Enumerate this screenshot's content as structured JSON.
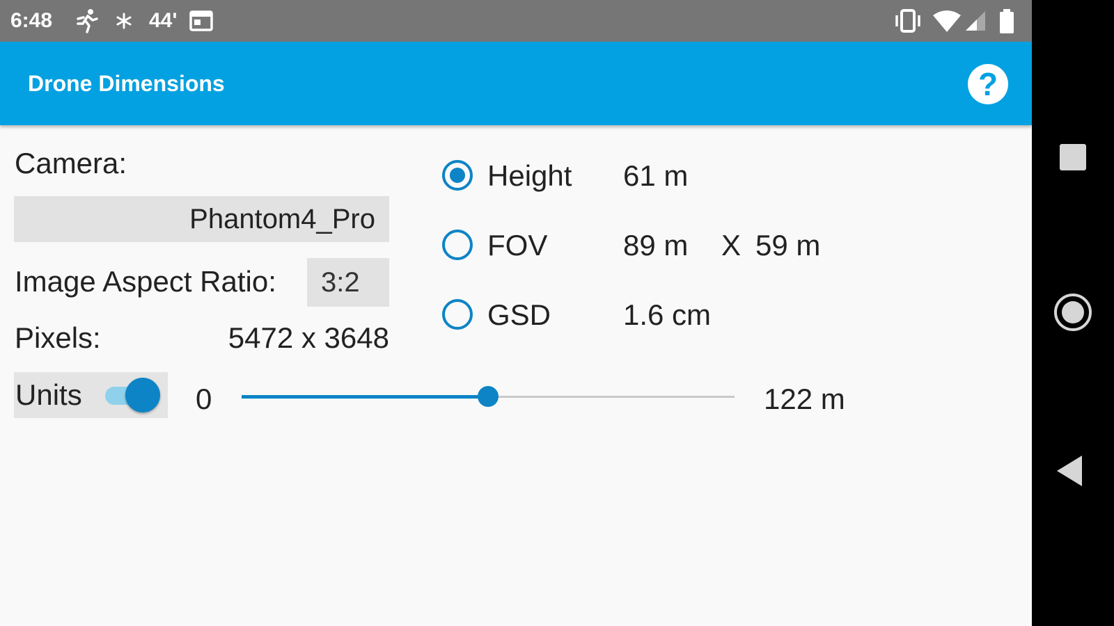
{
  "status_bar": {
    "time": "6:48",
    "temperature": "44'",
    "icons_left": [
      "running-icon",
      "snowflake-icon",
      "calendar-icon"
    ],
    "icons_right": [
      "vibrate-icon",
      "wifi-icon",
      "signal-icon",
      "battery-icon"
    ]
  },
  "app_bar": {
    "title": "Drone Dimensions",
    "help_label": "?"
  },
  "camera": {
    "label": "Camera:",
    "selected": "Phantom4_Pro"
  },
  "aspect_ratio": {
    "label": "Image Aspect Ratio:",
    "value": "3:2"
  },
  "pixels": {
    "label": "Pixels:",
    "value": "5472 x 3648"
  },
  "units": {
    "label": "Units",
    "checked": true
  },
  "slider": {
    "min_label": "0",
    "max_label": "122 m",
    "value_fraction": 0.5
  },
  "options": [
    {
      "label": "Height",
      "value": "61 m",
      "selected": true
    },
    {
      "label": "FOV",
      "value": "89 m",
      "separator": "X",
      "value2": "59 m",
      "selected": false
    },
    {
      "label": "GSD",
      "value": "1.6 cm",
      "selected": false
    }
  ],
  "colors": {
    "accent": "#03a1e1",
    "control": "#0d84c6",
    "status_bar": "#767676",
    "background": "#f9f9f9"
  },
  "nav_bar": {
    "buttons": [
      "recents-icon",
      "home-icon",
      "back-icon"
    ]
  }
}
